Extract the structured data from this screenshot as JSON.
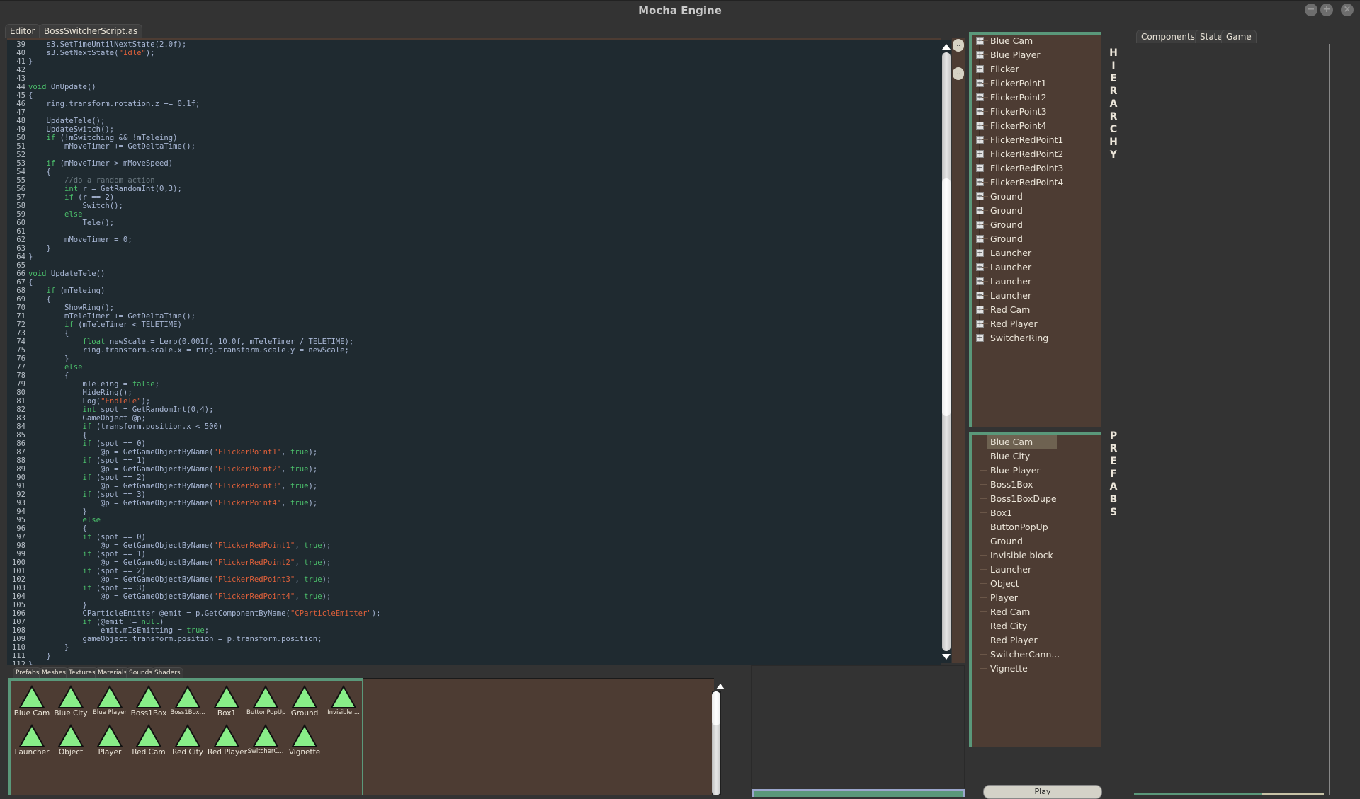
{
  "window": {
    "title": "Mocha Engine",
    "controls": [
      {
        "name": "minimize",
        "glyph": "−"
      },
      {
        "name": "maximize",
        "glyph": "+"
      },
      {
        "name": "close",
        "glyph": "×"
      }
    ]
  },
  "editor": {
    "tabs": [
      {
        "label": "Editor",
        "active": false
      },
      {
        "label": "BossSwitcherScript.as",
        "active": true
      }
    ],
    "first_line": 39,
    "lines": [
      "    s3.SetTimeUntilNextState(2.0f);",
      "    s3.SetNextState(\"Idle\");",
      "}",
      "",
      "",
      "void OnUpdate()",
      "{",
      "    ring.transform.rotation.z += 0.1f;",
      "",
      "    UpdateTele();",
      "    UpdateSwitch();",
      "    if (!mSwitching && !mTeleing)",
      "        mMoveTimer += GetDeltaTime();",
      "",
      "    if (mMoveTimer > mMoveSpeed)",
      "    {",
      "        //do a random action",
      "        int r = GetRandomInt(0,3);",
      "        if (r == 2)",
      "            Switch();",
      "        else",
      "            Tele();",
      "",
      "        mMoveTimer = 0;",
      "    }",
      "}",
      "",
      "void UpdateTele()",
      "{",
      "    if (mTeleing)",
      "    {",
      "        ShowRing();",
      "        mTeleTimer += GetDeltaTime();",
      "        if (mTeleTimer < TELETIME)",
      "        {",
      "            float newScale = Lerp(0.001f, 10.0f, mTeleTimer / TELETIME);",
      "            ring.transform.scale.x = ring.transform.scale.y = newScale;",
      "        }",
      "        else",
      "        {",
      "            mTeleing = false;",
      "            HideRing();",
      "            Log(\"EndTele\");",
      "            int spot = GetRandomInt(0,4);",
      "            GameObject @p;",
      "            if (transform.position.x < 500)",
      "            {",
      "            if (spot == 0)",
      "                @p = GetGameObjectByName(\"FlickerPoint1\", true);",
      "            if (spot == 1)",
      "                @p = GetGameObjectByName(\"FlickerPoint2\", true);",
      "            if (spot == 2)",
      "                @p = GetGameObjectByName(\"FlickerPoint3\", true);",
      "            if (spot == 3)",
      "                @p = GetGameObjectByName(\"FlickerPoint4\", true);",
      "            }",
      "            else",
      "            {",
      "            if (spot == 0)",
      "                @p = GetGameObjectByName(\"FlickerRedPoint1\", true);",
      "            if (spot == 1)",
      "                @p = GetGameObjectByName(\"FlickerRedPoint2\", true);",
      "            if (spot == 2)",
      "                @p = GetGameObjectByName(\"FlickerRedPoint3\", true);",
      "            if (spot == 3)",
      "                @p = GetGameObjectByName(\"FlickerRedPoint4\", true);",
      "            }",
      "            CParticleEmitter @emit = p.GetComponentByName(\"CParticleEmitter\");",
      "            if (@emit != null)",
      "                emit.mIsEmitting = true;",
      "            gameObject.transform.position = p.transform.position;",
      "        }",
      "    }",
      "}"
    ],
    "side_buttons": [
      "..",
      ".."
    ],
    "colors": {
      "background": "#1f2a30",
      "keyword": "#4bbf6b",
      "string": "#e0603a",
      "comment": "#6a7880",
      "text": "#a9b8d6"
    }
  },
  "hierarchy": {
    "label": "HIERARCHY",
    "items": [
      "Blue Cam",
      "Blue Player",
      "Flicker",
      "FlickerPoint1",
      "FlickerPoint2",
      "FlickerPoint3",
      "FlickerPoint4",
      "FlickerRedPoint1",
      "FlickerRedPoint2",
      "FlickerRedPoint3",
      "FlickerRedPoint4",
      "Ground",
      "Ground",
      "Ground",
      "Ground",
      "Launcher",
      "Launcher",
      "Launcher",
      "Launcher",
      "Red Cam",
      "Red Player",
      "SwitcherRing"
    ]
  },
  "prefabs": {
    "label": "PREFABS",
    "selected": "Blue Cam",
    "items": [
      "Blue Cam",
      "Blue City",
      "Blue Player",
      "Boss1Box",
      "Boss1BoxDupe",
      "Box1",
      "ButtonPopUp",
      "Ground",
      "Invisible block",
      "Launcher",
      "Object",
      "Player",
      "Red Cam",
      "Red City",
      "Red Player",
      "SwitcherCann...",
      "Vignette"
    ]
  },
  "assets": {
    "tabs": [
      "Prefabs",
      "Meshes",
      "Textures",
      "Materials",
      "Sounds",
      "Shaders"
    ],
    "active_tab": "Prefabs",
    "items": [
      "Blue Cam",
      "Blue City",
      "Blue Player",
      "Boss1Box",
      "Boss1Box...",
      "Box1",
      "ButtonPopUp",
      "Ground",
      "Invisible ...",
      "Launcher",
      "Object",
      "Player",
      "Red Cam",
      "Red City",
      "Red Player",
      "SwitcherC...",
      "Vignette"
    ],
    "icon": "triangle-prefab-icon",
    "icon_color": "#88ee88"
  },
  "inspector": {
    "tabs": [
      "Components",
      "State",
      "Game"
    ],
    "active_tab": "Components",
    "progress": 0.67
  },
  "play_button": {
    "label": "Play"
  }
}
